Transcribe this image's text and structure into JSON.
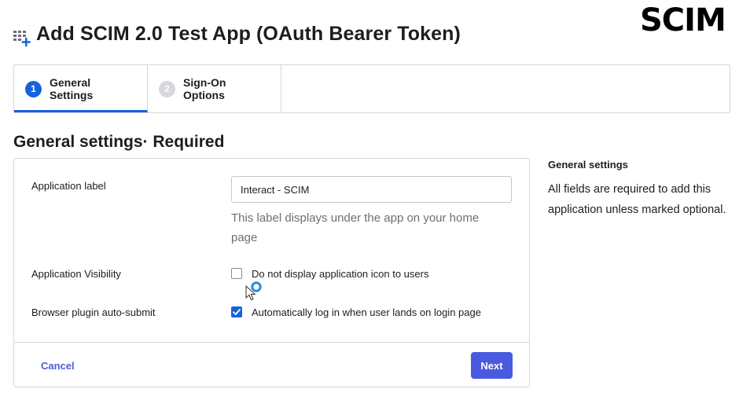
{
  "logo": "SCIM",
  "page_title": "Add SCIM 2.0 Test App (OAuth Bearer Token)",
  "tabs": [
    {
      "num": "1",
      "label": "General Settings",
      "active": true
    },
    {
      "num": "2",
      "label": "Sign-On Options",
      "active": false
    }
  ],
  "section_title": "General settings· Required",
  "form": {
    "app_label": {
      "label": "Application label",
      "value": "Interact - SCIM",
      "help": "This label displays under the app on your home page"
    },
    "visibility": {
      "label": "Application Visibility",
      "checkbox_label": "Do not display application icon to users",
      "checked": false
    },
    "auto_submit": {
      "label": "Browser plugin auto-submit",
      "checkbox_label": "Automatically log in when user lands on login page",
      "checked": true
    }
  },
  "footer": {
    "cancel": "Cancel",
    "next": "Next"
  },
  "sidebar": {
    "title": "General settings",
    "text": "All fields are required to add this application unless marked optional."
  },
  "colors": {
    "primary": "#1662dd",
    "button": "#4a5ae0",
    "link": "#4d5fd8",
    "border": "#d7d7dc"
  },
  "icons": {
    "app": "app-grid-add-icon",
    "cursor": "mouse-pointer-icon",
    "busy": "loading-spinner-icon",
    "check": "checkmark-icon"
  }
}
